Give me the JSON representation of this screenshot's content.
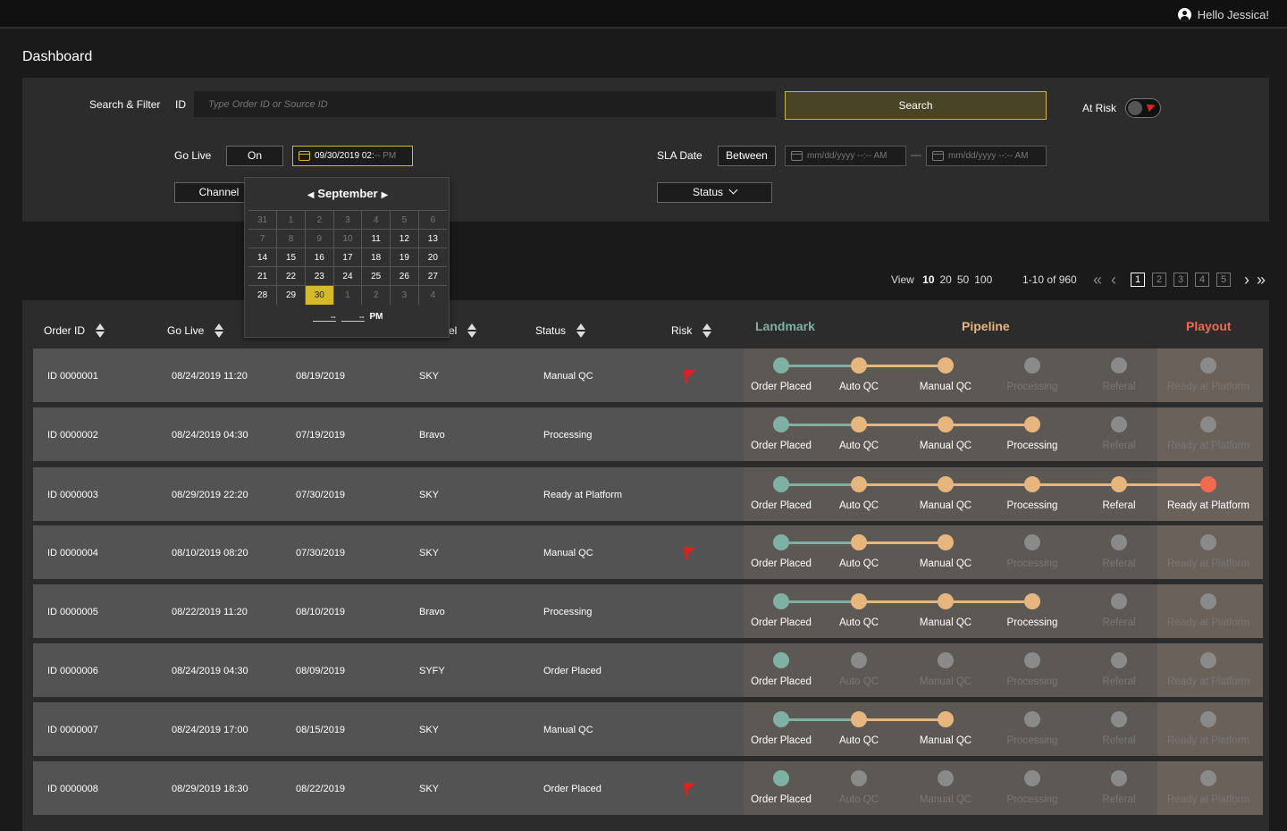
{
  "header": {
    "greeting": "Hello Jessica!",
    "user_icon": "user-circle-icon"
  },
  "page": {
    "title": "Dashboard"
  },
  "filters": {
    "search_filter_label": "Search & Filter",
    "id_label": "ID",
    "id_placeholder": "Type Order ID or Source ID",
    "search_button": "Search",
    "at_risk_label": "At Risk",
    "go_live_label": "Go Live",
    "go_live_mode": "On",
    "go_live_value": "09/30/2019 02:",
    "go_live_suffix": "-- PM",
    "sla_label": "SLA Date",
    "sla_mode": "Between",
    "sla_from_placeholder": "mm/dd/yyyy --:-- AM",
    "sla_to_placeholder": "mm/dd/yyyy --:-- AM",
    "range_sep": "—",
    "channel_button": "Channel",
    "status_button": "Status"
  },
  "calendar": {
    "month": "September",
    "prev": "◀",
    "next": "▶",
    "weeks": [
      [
        "31",
        "1",
        "2",
        "3",
        "4",
        "5",
        "6"
      ],
      [
        "7",
        "8",
        "9",
        "10",
        "11",
        "12",
        "13"
      ],
      [
        "14",
        "15",
        "16",
        "17",
        "18",
        "19",
        "20"
      ],
      [
        "21",
        "22",
        "23",
        "24",
        "25",
        "26",
        "27"
      ],
      [
        "28",
        "29",
        "30",
        "1",
        "2",
        "3",
        "4"
      ]
    ],
    "dim_cells": [
      "0-0",
      "0-1",
      "0-2",
      "0-3",
      "0-4",
      "0-5",
      "0-6",
      "1-0",
      "1-1",
      "1-2",
      "1-3",
      "4-3",
      "4-4",
      "4-5",
      "4-6"
    ],
    "selected": "30",
    "hour": "--",
    "minute": "--",
    "ampm": "PM"
  },
  "pagination": {
    "view_label": "View",
    "sizes": [
      "10",
      "20",
      "50",
      "100"
    ],
    "selected_size": "10",
    "range": "1-10 of 960",
    "pages": [
      "1",
      "2",
      "3",
      "4",
      "5"
    ],
    "current_page": "1",
    "first": "«",
    "prev": "‹",
    "next": "›",
    "last": "»"
  },
  "table": {
    "headers": {
      "order_id": "Order ID",
      "go_live": "Go Live",
      "channel": "el",
      "status": "Status",
      "risk": "Risk"
    },
    "stage_groups": [
      {
        "label": "Landmark",
        "color": "#7fb0a4"
      },
      {
        "label": "Pipeline",
        "color": "#e7b57e"
      },
      {
        "label": "Playout",
        "color": "#f26b4e"
      }
    ],
    "stages": [
      "Order Placed",
      "Auto QC",
      "Manual QC",
      "Processing",
      "Referal",
      "Ready at Platform"
    ],
    "stage_colors": {
      "landmark": "#7fb0a4",
      "pipeline": "#e7b57e",
      "playout": "#f26b4e",
      "inactive": "#8a8a8a"
    },
    "rows": [
      {
        "id": "ID 0000001",
        "go_live": "08/24/2019 11:20",
        "date2": "08/19/2019",
        "channel": "SKY",
        "status": "Manual QC",
        "at_risk": true,
        "progress": 3
      },
      {
        "id": "ID 0000002",
        "go_live": "08/24/2019 04:30",
        "date2": "07/19/2019",
        "channel": "Bravo",
        "status": "Processing",
        "at_risk": false,
        "progress": 4
      },
      {
        "id": "ID 0000003",
        "go_live": "08/29/2019 22:20",
        "date2": "07/30/2019",
        "channel": "SKY",
        "status": "Ready at Platform",
        "at_risk": false,
        "progress": 6
      },
      {
        "id": "ID 0000004",
        "go_live": "08/10/2019 08:20",
        "date2": "07/30/2019",
        "channel": "SKY",
        "status": "Manual QC",
        "at_risk": true,
        "progress": 3
      },
      {
        "id": "ID 0000005",
        "go_live": "08/22/2019 11:20",
        "date2": "08/10/2019",
        "channel": "Bravo",
        "status": "Processing",
        "at_risk": false,
        "progress": 4
      },
      {
        "id": "ID 0000006",
        "go_live": "08/24/2019 04:30",
        "date2": "08/09/2019",
        "channel": "SYFY",
        "status": "Order Placed",
        "at_risk": false,
        "progress": 1
      },
      {
        "id": "ID 0000007",
        "go_live": "08/24/2019 17:00",
        "date2": "08/15/2019",
        "channel": "SKY",
        "status": "Manual QC",
        "at_risk": false,
        "progress": 3
      },
      {
        "id": "ID 0000008",
        "go_live": "08/29/2019 18:30",
        "date2": "08/22/2019",
        "channel": "SKY",
        "status": "Order Placed",
        "at_risk": true,
        "progress": 1
      }
    ]
  }
}
